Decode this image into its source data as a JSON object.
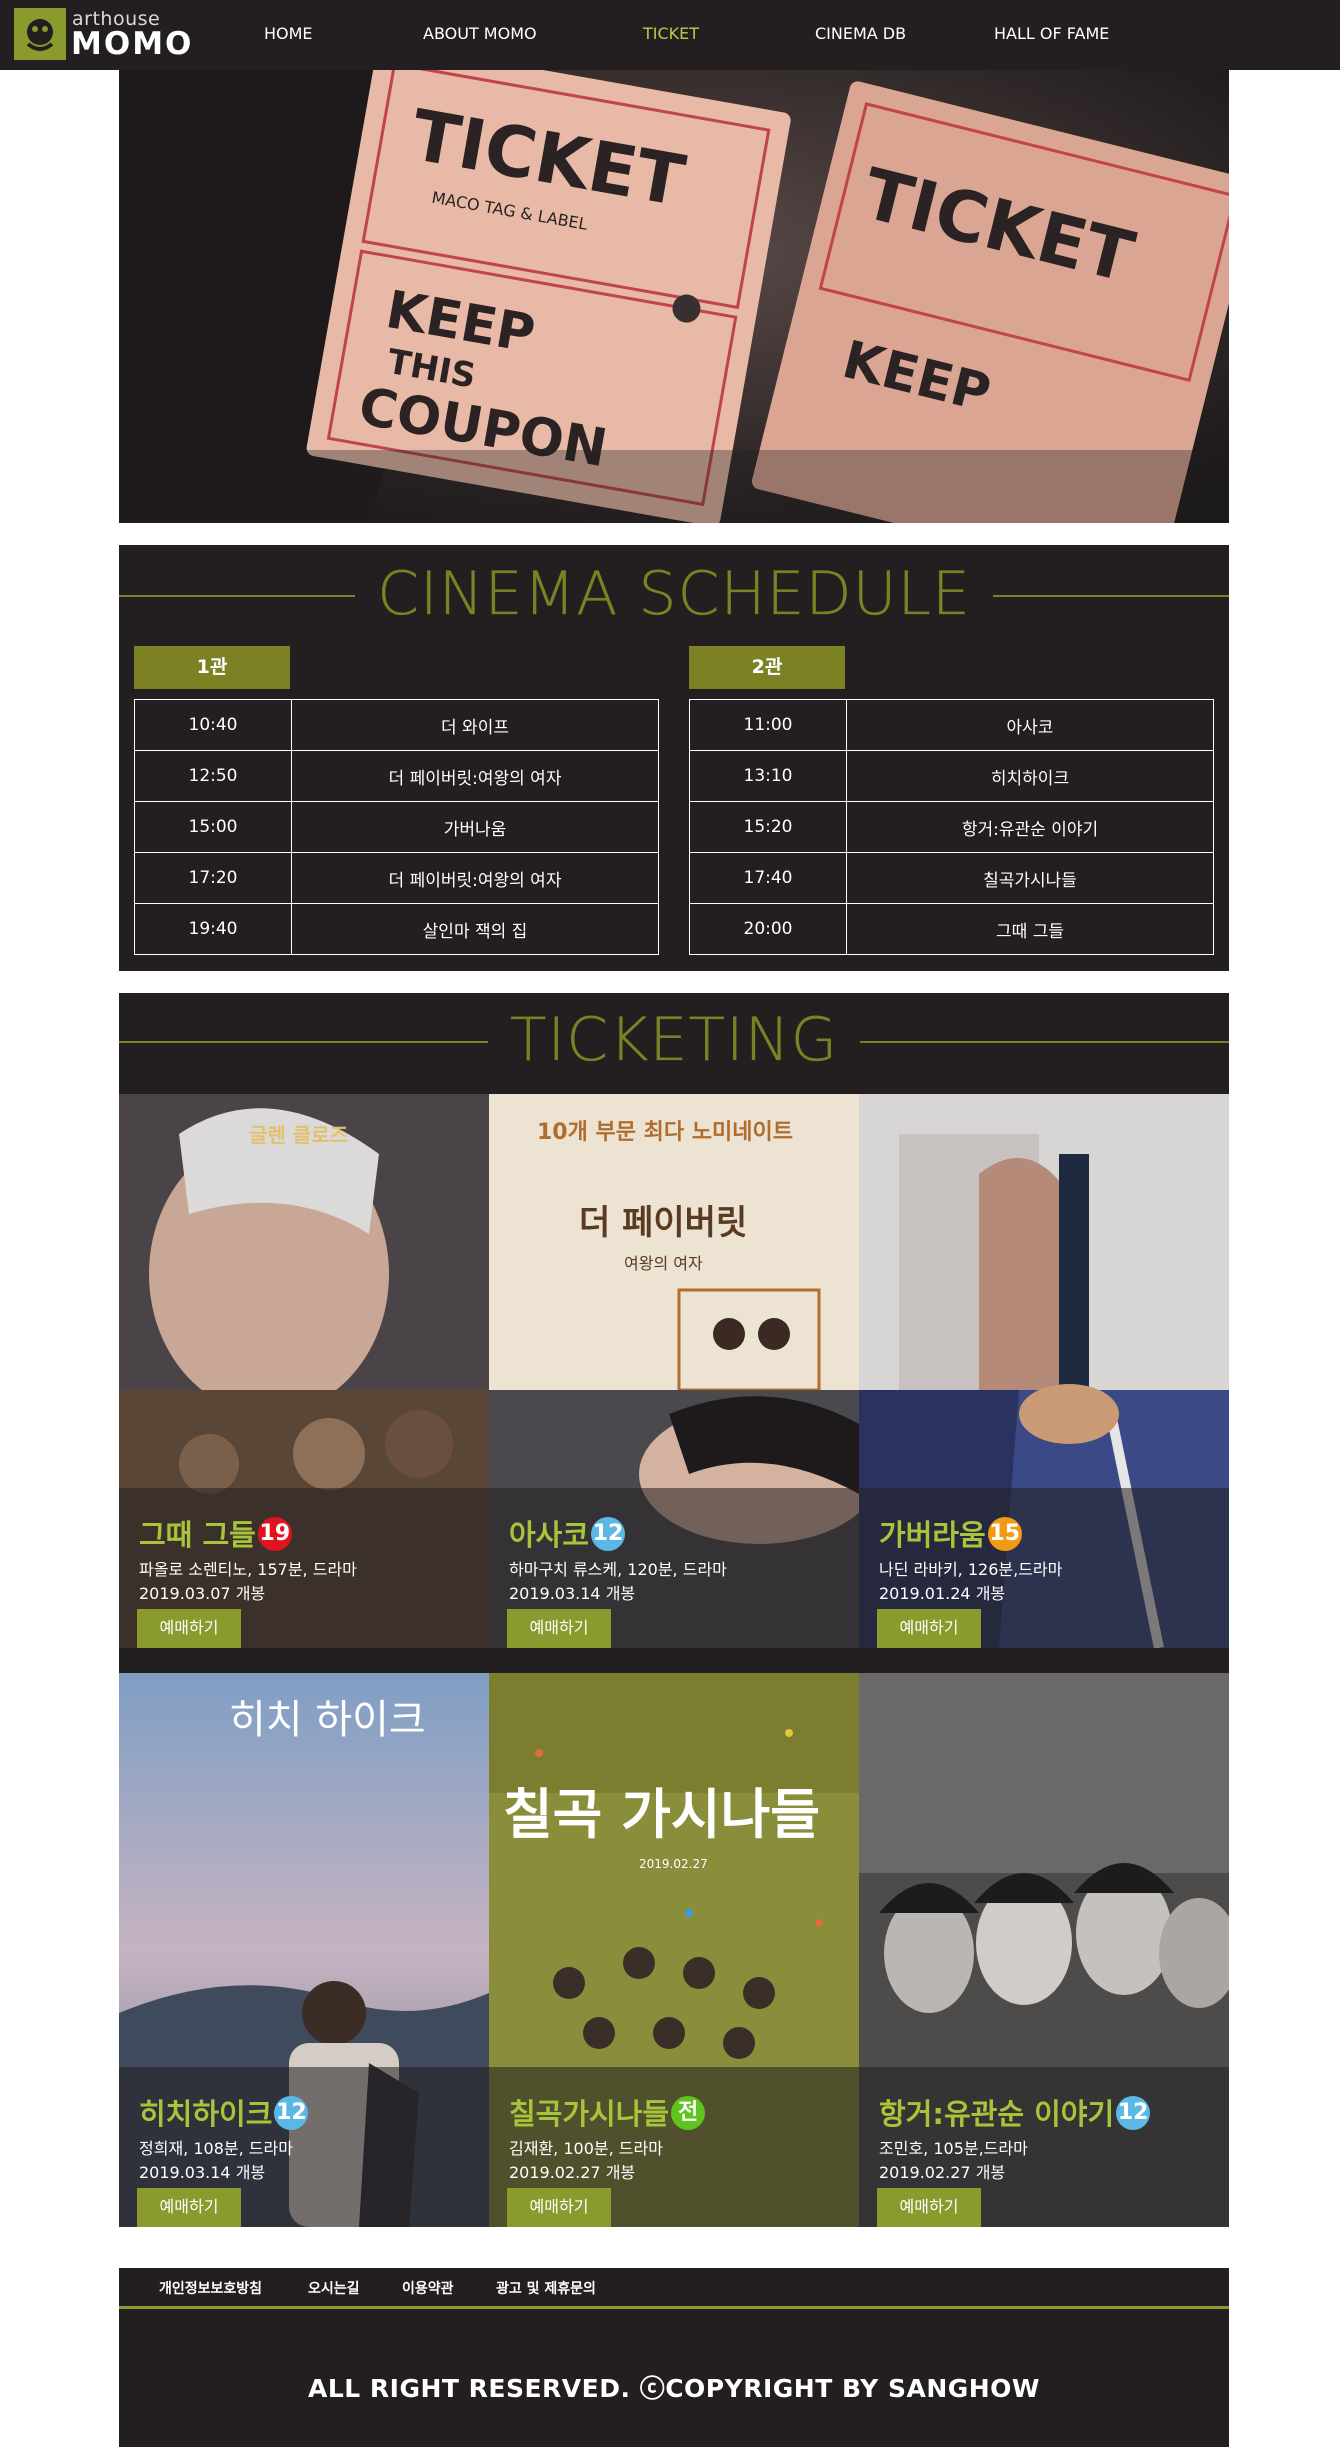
{
  "brand": {
    "small": "arthouse",
    "big": "MOMO"
  },
  "nav": [
    {
      "label": "HOME",
      "active": false
    },
    {
      "label": "ABOUT MOMO",
      "active": false
    },
    {
      "label": "TICKET",
      "active": true
    },
    {
      "label": "CINEMA DB",
      "active": false
    },
    {
      "label": "HALL OF FAME",
      "active": false
    }
  ],
  "schedule": {
    "title": "CINEMA SCHEDULE",
    "halls": [
      {
        "name": "1관",
        "rows": [
          {
            "time": "10:40",
            "movie": "더 와이프"
          },
          {
            "time": "12:50",
            "movie": "더 페이버릿:여왕의 여자"
          },
          {
            "time": "15:00",
            "movie": "가버나움"
          },
          {
            "time": "17:20",
            "movie": "더 페이버릿:여왕의 여자"
          },
          {
            "time": "19:40",
            "movie": "살인마 잭의 집"
          }
        ]
      },
      {
        "name": "2관",
        "rows": [
          {
            "time": "11:00",
            "movie": "아사코"
          },
          {
            "time": "13:10",
            "movie": "히치하이크"
          },
          {
            "time": "15:20",
            "movie": "항거:유관순 이야기"
          },
          {
            "time": "17:40",
            "movie": "칠곡가시나들"
          },
          {
            "time": "20:00",
            "movie": "그때 그들"
          }
        ]
      }
    ]
  },
  "ticketing": {
    "title": "TICKETING",
    "reserve_label": "예매하기",
    "movies": [
      {
        "title": "그때 그들",
        "rating": "19",
        "rating_color": "#e0141e",
        "info": "파올로 소렌티노, 157분, 드라마",
        "date": "2019.03.07 개봉"
      },
      {
        "title": "아사코",
        "rating": "12",
        "rating_color": "#5bb8e6",
        "info": "하마구치 류스케, 120분, 드라마",
        "date": "2019.03.14 개봉"
      },
      {
        "title": "가버라움",
        "rating": "15",
        "rating_color": "#f29a14",
        "info": "나딘 라바키, 126분,드라마",
        "date": "2019.01.24 개봉"
      },
      {
        "title": "히치하이크",
        "rating": "12",
        "rating_color": "#5bb8e6",
        "info": "정희재, 108분, 드라마",
        "date": "2019.03.14 개봉"
      },
      {
        "title": "칠곡가시나들",
        "rating": "전",
        "rating_color": "#5fc41e",
        "info": "김재환, 100분, 드라마",
        "date": "2019.02.27 개봉"
      },
      {
        "title": "항거:유관순 이야기",
        "rating": "12",
        "rating_color": "#5bb8e6",
        "info": "조민호, 105분,드라마",
        "date": "2019.02.27 개봉"
      }
    ]
  },
  "posters": {
    "glenn": "글렌 클로즈",
    "favourite": "더 페이버릿",
    "favourite_sub": "여왕의 여자",
    "favourite_top": "10개 부문 최다 노미네이트",
    "hitch": "히치 하이크",
    "chilgok": "칠곡 가시나들",
    "chilgok_date": "2019.02.27"
  },
  "footer": {
    "links": [
      "개인정보보호방침",
      "오시는길",
      "이용약관",
      "광고 및 제휴문의"
    ],
    "copyright": "ALL RIGHT RESERVED. ⓒCOPYRIGHT BY SANGHOW"
  }
}
